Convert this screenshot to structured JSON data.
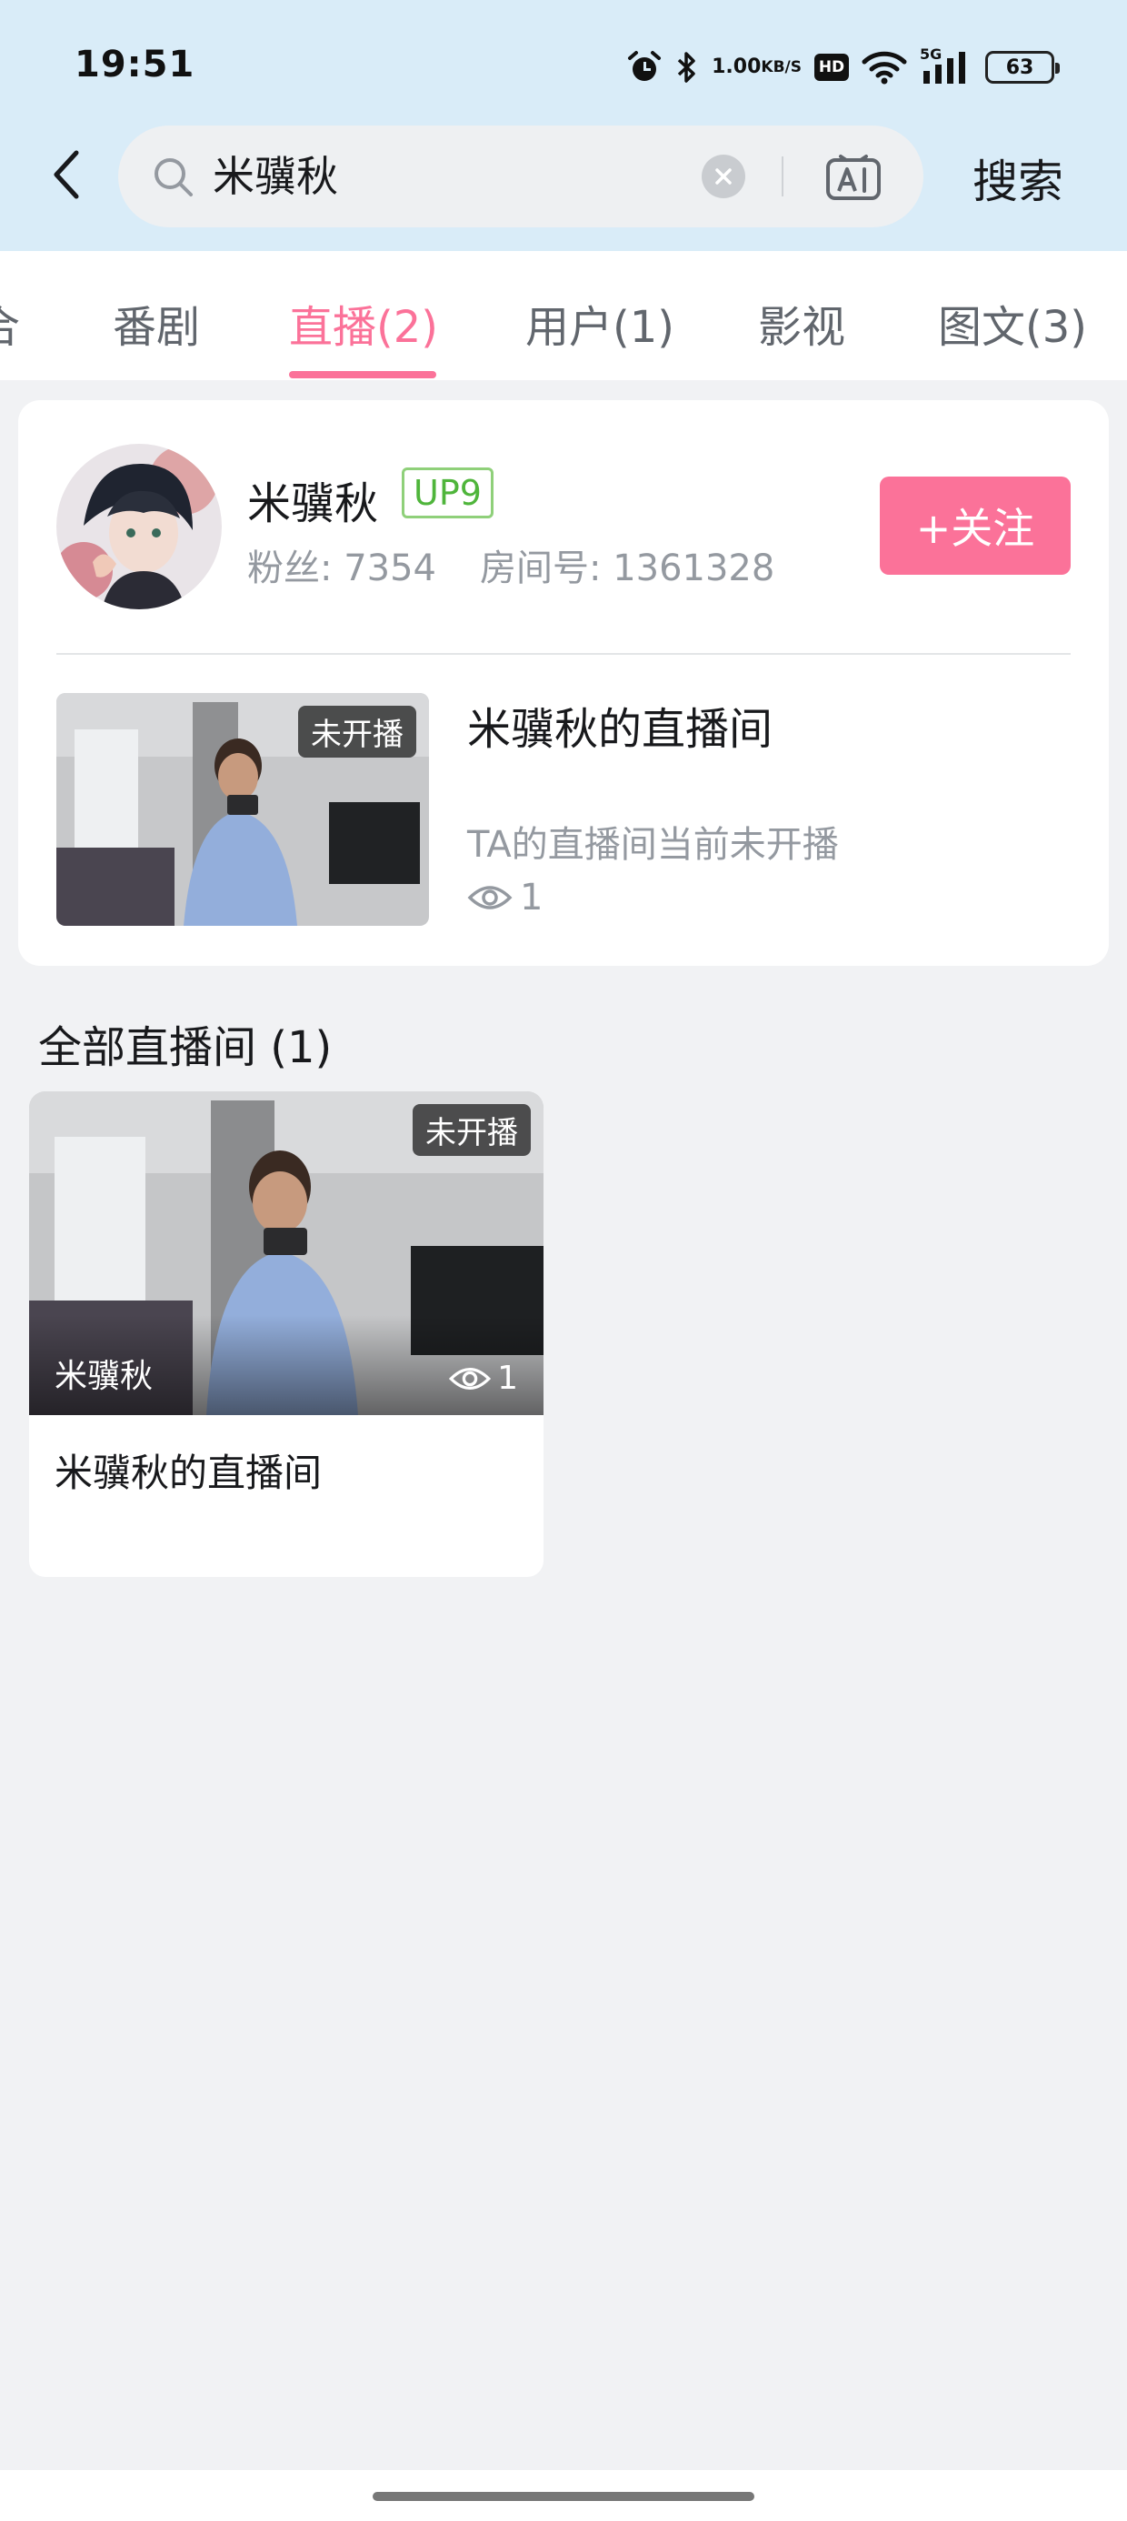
{
  "status_bar": {
    "time": "19:51",
    "net_speed_value": "1.00",
    "net_speed_unit": "KB/S",
    "hd_label": "HD",
    "signal_label": "5G",
    "battery_level": "63",
    "icons": [
      "alarm-icon",
      "bluetooth-icon",
      "wifi-icon",
      "cellular-signal-icon",
      "battery-icon"
    ]
  },
  "search": {
    "query": "米骥秋",
    "submit_label": "搜索"
  },
  "tabs": [
    {
      "label": "合"
    },
    {
      "label": "番剧"
    },
    {
      "label": "直播(2)",
      "active": true
    },
    {
      "label": "用户(1)"
    },
    {
      "label": "影视"
    },
    {
      "label": "图文(3)"
    }
  ],
  "user_card": {
    "name": "米骥秋",
    "level_badge": "UP9",
    "fans": "粉丝: 7354",
    "room_id": "房间号: 1361328",
    "follow_label": "+关注",
    "room": {
      "status_badge": "未开播",
      "title": "米骥秋的直播间",
      "status_text": "TA的直播间当前未开播",
      "views": "1"
    }
  },
  "all_rooms": {
    "title": "全部直播间 (1)",
    "items": [
      {
        "status_badge": "未开播",
        "owner": "米骥秋",
        "views": "1",
        "title": "米骥秋的直播间"
      }
    ]
  },
  "colors": {
    "accent": "#fb7299",
    "header_bg": "#d9ecf8",
    "level_green": "#4fb53b",
    "page_bg": "#f1f2f4"
  }
}
